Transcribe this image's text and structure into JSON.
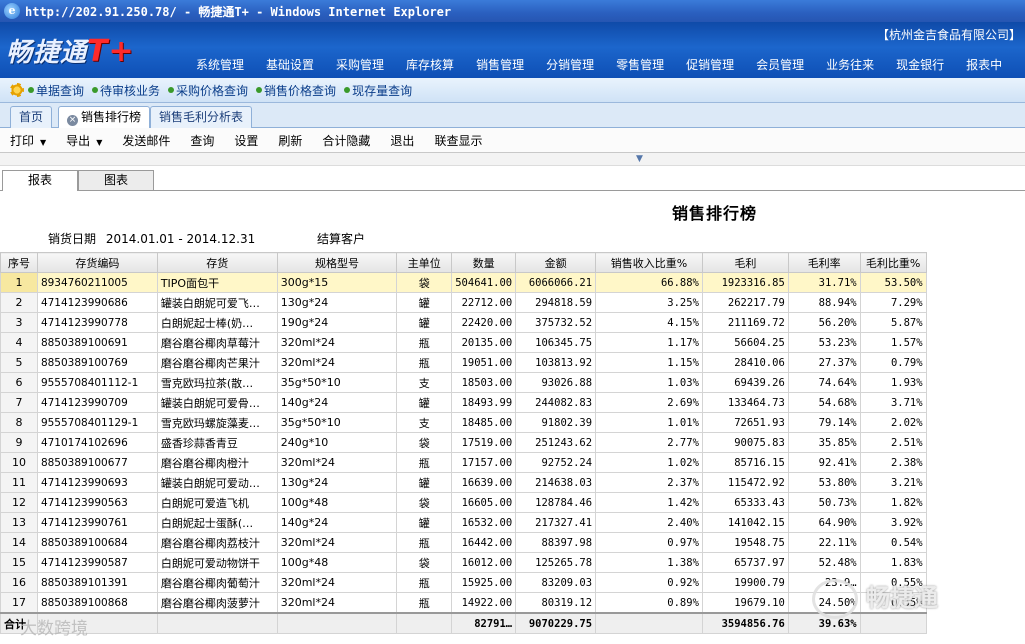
{
  "window": {
    "title": "http://202.91.250.78/ - 畅捷通T+ - Windows Internet Explorer"
  },
  "app": {
    "logo_text": "畅捷通",
    "logo_suffix": "T+",
    "company": "【杭州金吉食品有限公司】",
    "menu": [
      "系统管理",
      "基础设置",
      "采购管理",
      "库存核算",
      "销售管理",
      "分销管理",
      "零售管理",
      "促销管理",
      "会员管理",
      "业务往来",
      "现金银行",
      "报表中"
    ]
  },
  "shortcuts": [
    "单据查询",
    "待审核业务",
    "采购价格查询",
    "销售价格查询",
    "现存量查询"
  ],
  "tabs": [
    "首页",
    "销售排行榜",
    "销售毛利分析表"
  ],
  "toolbar": [
    "打印",
    "导出",
    "发送邮件",
    "查询",
    "设置",
    "刷新",
    "合计隐藏",
    "退出",
    "联查显示"
  ],
  "report_tabs": [
    "报表",
    "图表"
  ],
  "report": {
    "title": "销售排行榜",
    "date_label": "销货日期",
    "date_range": "2014.01.01 - 2014.12.31",
    "customer_label": "结算客户"
  },
  "columns": [
    "序号",
    "存货编码",
    "存货",
    "规格型号",
    "主单位",
    "数量",
    "金额",
    "销售收入比重%",
    "毛利",
    "毛利率",
    "毛利比重%"
  ],
  "rows": [
    [
      "1",
      "8934760211005",
      "TIPO面包干",
      "300g*15",
      "袋",
      "504641.00",
      "6066066.21",
      "66.88%",
      "1923316.85",
      "31.71%",
      "53.50%"
    ],
    [
      "2",
      "4714123990686",
      "罐装白朗妮可爱飞…",
      "130g*24",
      "罐",
      "22712.00",
      "294818.59",
      "3.25%",
      "262217.79",
      "88.94%",
      "7.29%"
    ],
    [
      "3",
      "4714123990778",
      "白朗妮起士棒(奶…",
      "190g*24",
      "罐",
      "22420.00",
      "375732.52",
      "4.15%",
      "211169.72",
      "56.20%",
      "5.87%"
    ],
    [
      "4",
      "8850389100691",
      "磨谷磨谷椰肉草莓汁",
      "320ml*24",
      "瓶",
      "20135.00",
      "106345.75",
      "1.17%",
      "56604.25",
      "53.23%",
      "1.57%"
    ],
    [
      "5",
      "8850389100769",
      "磨谷磨谷椰肉芒果汁",
      "320ml*24",
      "瓶",
      "19051.00",
      "103813.92",
      "1.15%",
      "28410.06",
      "27.37%",
      "0.79%"
    ],
    [
      "6",
      "9555708401112-1",
      "雪克欧玛拉茶(散…",
      "35g*50*10",
      "支",
      "18503.00",
      "93026.88",
      "1.03%",
      "69439.26",
      "74.64%",
      "1.93%"
    ],
    [
      "7",
      "4714123990709",
      "罐装白朗妮可爱骨…",
      "140g*24",
      "罐",
      "18493.99",
      "244082.83",
      "2.69%",
      "133464.73",
      "54.68%",
      "3.71%"
    ],
    [
      "8",
      "9555708401129-1",
      "雪克欧玛螺旋藻麦…",
      "35g*50*10",
      "支",
      "18485.00",
      "91802.39",
      "1.01%",
      "72651.93",
      "79.14%",
      "2.02%"
    ],
    [
      "9",
      "4710174102696",
      "盛香珍蒜香青豆",
      "240g*10",
      "袋",
      "17519.00",
      "251243.62",
      "2.77%",
      "90075.83",
      "35.85%",
      "2.51%"
    ],
    [
      "10",
      "8850389100677",
      "磨谷磨谷椰肉橙汁",
      "320ml*24",
      "瓶",
      "17157.00",
      "92752.24",
      "1.02%",
      "85716.15",
      "92.41%",
      "2.38%"
    ],
    [
      "11",
      "4714123990693",
      "罐装白朗妮可爱动…",
      "130g*24",
      "罐",
      "16639.00",
      "214638.03",
      "2.37%",
      "115472.92",
      "53.80%",
      "3.21%"
    ],
    [
      "12",
      "4714123990563",
      "白朗妮可爱造飞机",
      "100g*48",
      "袋",
      "16605.00",
      "128784.46",
      "1.42%",
      "65333.43",
      "50.73%",
      "1.82%"
    ],
    [
      "13",
      "4714123990761",
      "白朗妮起士蛋酥(…",
      "140g*24",
      "罐",
      "16532.00",
      "217327.41",
      "2.40%",
      "141042.15",
      "64.90%",
      "3.92%"
    ],
    [
      "14",
      "8850389100684",
      "磨谷磨谷椰肉荔枝汁",
      "320ml*24",
      "瓶",
      "16442.00",
      "88397.98",
      "0.97%",
      "19548.75",
      "22.11%",
      "0.54%"
    ],
    [
      "15",
      "4714123990587",
      "白朗妮可爱动物饼干",
      "100g*48",
      "袋",
      "16012.00",
      "125265.78",
      "1.38%",
      "65737.97",
      "52.48%",
      "1.83%"
    ],
    [
      "16",
      "8850389101391",
      "磨谷磨谷椰肉葡萄汁",
      "320ml*24",
      "瓶",
      "15925.00",
      "83209.03",
      "0.92%",
      "19900.79",
      "23.9…",
      "0.55%"
    ],
    [
      "17",
      "8850389100868",
      "磨谷磨谷椰肉菠萝汁",
      "320ml*24",
      "瓶",
      "14922.00",
      "80319.12",
      "0.89%",
      "19679.10",
      "24.50%",
      "0.55%"
    ]
  ],
  "totals": [
    "合计",
    "",
    "",
    "",
    "",
    "82791…",
    "9070229.75",
    "",
    "3594856.76",
    "39.63%",
    ""
  ],
  "watermarks": {
    "left": "大数跨境",
    "right": "畅捷通"
  }
}
